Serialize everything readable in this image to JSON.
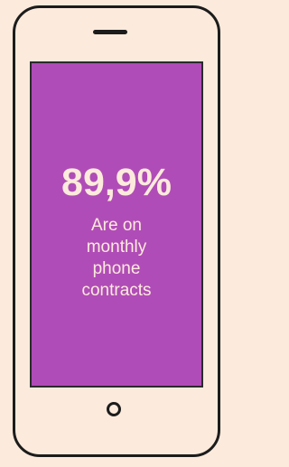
{
  "screen": {
    "stat": "89,9%",
    "caption_lines": [
      "Are on",
      "monthly",
      "phone",
      "contracts"
    ]
  },
  "colors": {
    "background": "#fcebdc",
    "screen": "#b04cb7",
    "outline": "#1c1c1c",
    "text": "#fcebdc"
  },
  "icons": {
    "device": "smartphone-icon",
    "speaker": "speaker-slot-icon",
    "home": "home-button-icon"
  }
}
